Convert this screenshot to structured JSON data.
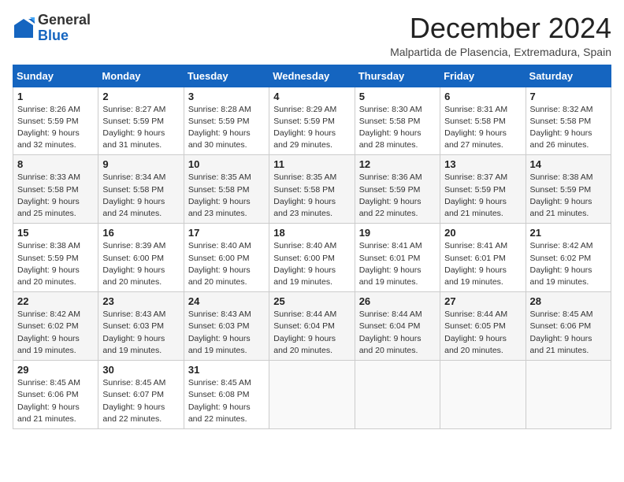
{
  "logo": {
    "general": "General",
    "blue": "Blue"
  },
  "header": {
    "month": "December 2024",
    "location": "Malpartida de Plasencia, Extremadura, Spain"
  },
  "days_of_week": [
    "Sunday",
    "Monday",
    "Tuesday",
    "Wednesday",
    "Thursday",
    "Friday",
    "Saturday"
  ],
  "weeks": [
    [
      {
        "day": "1",
        "sunrise": "8:26 AM",
        "sunset": "5:59 PM",
        "daylight": "9 hours and 32 minutes."
      },
      {
        "day": "2",
        "sunrise": "8:27 AM",
        "sunset": "5:59 PM",
        "daylight": "9 hours and 31 minutes."
      },
      {
        "day": "3",
        "sunrise": "8:28 AM",
        "sunset": "5:59 PM",
        "daylight": "9 hours and 30 minutes."
      },
      {
        "day": "4",
        "sunrise": "8:29 AM",
        "sunset": "5:59 PM",
        "daylight": "9 hours and 29 minutes."
      },
      {
        "day": "5",
        "sunrise": "8:30 AM",
        "sunset": "5:58 PM",
        "daylight": "9 hours and 28 minutes."
      },
      {
        "day": "6",
        "sunrise": "8:31 AM",
        "sunset": "5:58 PM",
        "daylight": "9 hours and 27 minutes."
      },
      {
        "day": "7",
        "sunrise": "8:32 AM",
        "sunset": "5:58 PM",
        "daylight": "9 hours and 26 minutes."
      }
    ],
    [
      {
        "day": "8",
        "sunrise": "8:33 AM",
        "sunset": "5:58 PM",
        "daylight": "9 hours and 25 minutes."
      },
      {
        "day": "9",
        "sunrise": "8:34 AM",
        "sunset": "5:58 PM",
        "daylight": "9 hours and 24 minutes."
      },
      {
        "day": "10",
        "sunrise": "8:35 AM",
        "sunset": "5:58 PM",
        "daylight": "9 hours and 23 minutes."
      },
      {
        "day": "11",
        "sunrise": "8:35 AM",
        "sunset": "5:58 PM",
        "daylight": "9 hours and 23 minutes."
      },
      {
        "day": "12",
        "sunrise": "8:36 AM",
        "sunset": "5:59 PM",
        "daylight": "9 hours and 22 minutes."
      },
      {
        "day": "13",
        "sunrise": "8:37 AM",
        "sunset": "5:59 PM",
        "daylight": "9 hours and 21 minutes."
      },
      {
        "day": "14",
        "sunrise": "8:38 AM",
        "sunset": "5:59 PM",
        "daylight": "9 hours and 21 minutes."
      }
    ],
    [
      {
        "day": "15",
        "sunrise": "8:38 AM",
        "sunset": "5:59 PM",
        "daylight": "9 hours and 20 minutes."
      },
      {
        "day": "16",
        "sunrise": "8:39 AM",
        "sunset": "6:00 PM",
        "daylight": "9 hours and 20 minutes."
      },
      {
        "day": "17",
        "sunrise": "8:40 AM",
        "sunset": "6:00 PM",
        "daylight": "9 hours and 20 minutes."
      },
      {
        "day": "18",
        "sunrise": "8:40 AM",
        "sunset": "6:00 PM",
        "daylight": "9 hours and 19 minutes."
      },
      {
        "day": "19",
        "sunrise": "8:41 AM",
        "sunset": "6:01 PM",
        "daylight": "9 hours and 19 minutes."
      },
      {
        "day": "20",
        "sunrise": "8:41 AM",
        "sunset": "6:01 PM",
        "daylight": "9 hours and 19 minutes."
      },
      {
        "day": "21",
        "sunrise": "8:42 AM",
        "sunset": "6:02 PM",
        "daylight": "9 hours and 19 minutes."
      }
    ],
    [
      {
        "day": "22",
        "sunrise": "8:42 AM",
        "sunset": "6:02 PM",
        "daylight": "9 hours and 19 minutes."
      },
      {
        "day": "23",
        "sunrise": "8:43 AM",
        "sunset": "6:03 PM",
        "daylight": "9 hours and 19 minutes."
      },
      {
        "day": "24",
        "sunrise": "8:43 AM",
        "sunset": "6:03 PM",
        "daylight": "9 hours and 19 minutes."
      },
      {
        "day": "25",
        "sunrise": "8:44 AM",
        "sunset": "6:04 PM",
        "daylight": "9 hours and 20 minutes."
      },
      {
        "day": "26",
        "sunrise": "8:44 AM",
        "sunset": "6:04 PM",
        "daylight": "9 hours and 20 minutes."
      },
      {
        "day": "27",
        "sunrise": "8:44 AM",
        "sunset": "6:05 PM",
        "daylight": "9 hours and 20 minutes."
      },
      {
        "day": "28",
        "sunrise": "8:45 AM",
        "sunset": "6:06 PM",
        "daylight": "9 hours and 21 minutes."
      }
    ],
    [
      {
        "day": "29",
        "sunrise": "8:45 AM",
        "sunset": "6:06 PM",
        "daylight": "9 hours and 21 minutes."
      },
      {
        "day": "30",
        "sunrise": "8:45 AM",
        "sunset": "6:07 PM",
        "daylight": "9 hours and 22 minutes."
      },
      {
        "day": "31",
        "sunrise": "8:45 AM",
        "sunset": "6:08 PM",
        "daylight": "9 hours and 22 minutes."
      },
      null,
      null,
      null,
      null
    ]
  ]
}
